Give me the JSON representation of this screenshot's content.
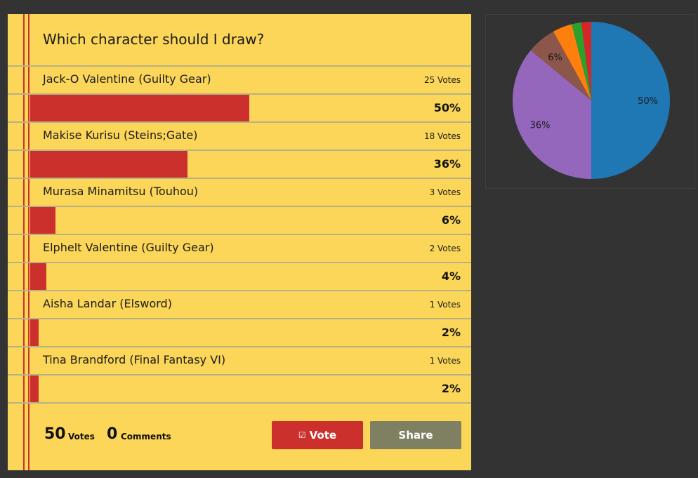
{
  "poll": {
    "question": "Which character should I draw?",
    "options": [
      {
        "label": "Jack-O Valentine (Guilty Gear)",
        "votes": "25 Votes",
        "pct": "50%",
        "fraction": 0.5
      },
      {
        "label": "Makise Kurisu (Steins;Gate)",
        "votes": "18 Votes",
        "pct": "36%",
        "fraction": 0.36
      },
      {
        "label": "Murasa Minamitsu (Touhou)",
        "votes": "3 Votes",
        "pct": "6%",
        "fraction": 0.06
      },
      {
        "label": "Elphelt Valentine (Guilty Gear)",
        "votes": "2 Votes",
        "pct": "4%",
        "fraction": 0.04
      },
      {
        "label": "Aisha Landar (Elsword)",
        "votes": "1 Votes",
        "pct": "2%",
        "fraction": 0.02
      },
      {
        "label": "Tina Brandford (Final Fantasy VI)",
        "votes": "1 Votes",
        "pct": "2%",
        "fraction": 0.02
      }
    ],
    "total_votes": "50",
    "votes_word": "Votes",
    "total_comments": "0",
    "comments_word": "Comments",
    "vote_button": "Vote",
    "share_button": "Share"
  },
  "chart_data": {
    "type": "pie",
    "slices": [
      {
        "value": 50,
        "label": "50%",
        "color": "#1f77b4"
      },
      {
        "value": 36,
        "label": "36%",
        "color": "#9467bd"
      },
      {
        "value": 6,
        "label": "6%",
        "color": "#8c564b"
      },
      {
        "value": 4,
        "label": "",
        "color": "#ff7f0e"
      },
      {
        "value": 2,
        "label": "",
        "color": "#2ca02c"
      },
      {
        "value": 2,
        "label": "",
        "color": "#d62728"
      }
    ]
  },
  "colors": {
    "paper": "#fcd658",
    "bar": "#cb302c",
    "vote_button": "#cb302c",
    "share_button": "#7f8062",
    "background": "#333333"
  },
  "icons": {
    "vote": "check-square-icon"
  }
}
